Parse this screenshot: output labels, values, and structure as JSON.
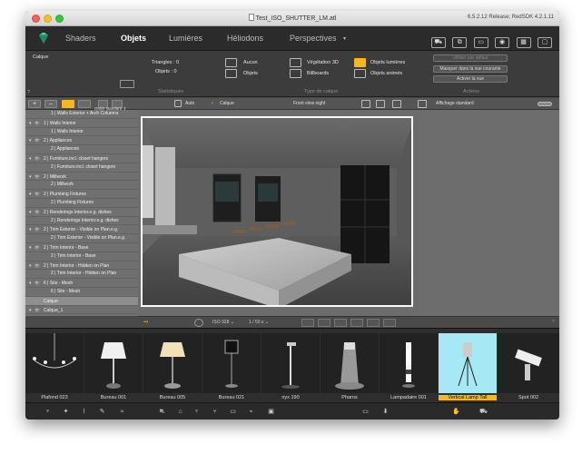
{
  "window": {
    "title": "Test_ISO_SHUTTER_LM.atl",
    "version": "6.5.2.12 Release; RedSDK 4.2.1.11"
  },
  "menu": {
    "tabs": [
      "Shaders",
      "Objets",
      "Lumières",
      "Héliodons",
      "Perspectives"
    ],
    "perspectives_arrow": "▾",
    "toolbar_icons": [
      "cart-icon",
      "layers-icon",
      "display-icon",
      "camera-icon",
      "film-icon",
      "screen-icon"
    ]
  },
  "info_panel": {
    "layer_label": "Calque",
    "triangles": "Triangles : 0",
    "objects": "Objets : 0",
    "stats_label": "Statistiques",
    "layer_type_label": "Type de calque",
    "actions_label": "Actions",
    "type_options": [
      {
        "label": "Aucun",
        "icon": "box-icon",
        "active": false
      },
      {
        "label": "Objets",
        "icon": "cube-icon",
        "active": false
      },
      {
        "label": "Végétation 3D",
        "icon": "tree-icon",
        "active": false
      },
      {
        "label": "Billboards",
        "icon": "billboard-icon",
        "active": false
      },
      {
        "label": "Objets lumières",
        "icon": "lamp-icon",
        "active": true
      },
      {
        "label": "Objets animés",
        "icon": "animation-icon",
        "active": false
      }
    ],
    "actions": [
      "Utiliser par défaut",
      "Masquer dans la vue courante",
      "Activer la vue"
    ],
    "help": "?"
  },
  "layer_toolbar": {
    "sort_label": "Ordre standard ⇕",
    "plus": "+",
    "minus": "–"
  },
  "layers": [
    {
      "kind": "s",
      "text": "1 | Walls Exterior + Arch Columns"
    },
    {
      "kind": "g",
      "text": "1 | Walls Interior"
    },
    {
      "kind": "s",
      "text": "1 | Walls Interior"
    },
    {
      "kind": "g",
      "text": "2 | Appliances"
    },
    {
      "kind": "s",
      "text": "2 | Appliances"
    },
    {
      "kind": "g",
      "text": "2 | Furniture.incl. closet hangers"
    },
    {
      "kind": "s",
      "text": "2 | Furniture.incl. closet hangers"
    },
    {
      "kind": "g",
      "text": "2 | Millwork"
    },
    {
      "kind": "s",
      "text": "2 | Millwork"
    },
    {
      "kind": "g",
      "text": "2 | Plumbing Fixtures"
    },
    {
      "kind": "s",
      "text": "2 | Plumbing Fixtures"
    },
    {
      "kind": "g",
      "text": "2 | Renderings Interior.e.g. dishes"
    },
    {
      "kind": "s",
      "text": "2 | Renderings Interior.e.g. dishes"
    },
    {
      "kind": "g",
      "text": "2 | Trim Exterior - Visible on Plan.e.g."
    },
    {
      "kind": "s",
      "text": "2 | Trim Exterior - Visible on Plan.e.g."
    },
    {
      "kind": "g",
      "text": "2 | Trim Interior - Base"
    },
    {
      "kind": "s",
      "text": "2 | Trim Interior - Base"
    },
    {
      "kind": "g",
      "text": "2 | Trim Interior - Hidden on Plan"
    },
    {
      "kind": "s",
      "text": "2 | Trim Interior - Hidden on Plan"
    },
    {
      "kind": "g",
      "text": "6 | Site - Mesh"
    },
    {
      "kind": "s",
      "text": "6 | Site - Mesh"
    },
    {
      "kind": "sel",
      "text": "Calque"
    },
    {
      "kind": "g",
      "text": "Calque_1"
    }
  ],
  "view_toolbar": {
    "auto": "Auto",
    "layer": "Calque",
    "view_name": "Front view night",
    "display": "Affichage standard"
  },
  "view_bottom": {
    "dots": "•••",
    "iso": "ISO 928 ⌄",
    "shutter": "1 / 50 s ⌄",
    "help": "?"
  },
  "objects": [
    {
      "name": "Plafond 023",
      "selected": false
    },
    {
      "name": "Bureau 001",
      "selected": false
    },
    {
      "name": "Bureau 005",
      "selected": false
    },
    {
      "name": "Bureau 021",
      "selected": false
    },
    {
      "name": "nyx 190",
      "selected": false
    },
    {
      "name": "Pharos",
      "selected": false
    },
    {
      "name": "Lampadaire 001",
      "selected": false
    },
    {
      "name": "Vertical Lamp Tall",
      "selected": true
    },
    {
      "name": "Spot 002",
      "selected": false
    }
  ],
  "footer_icons": [
    "lamp-icon",
    "bulb-icon",
    "stair-icon",
    "pen-icon",
    "wave-icon",
    "car-icon",
    "sofa-icon",
    "lamp-icon",
    "chair-icon",
    "bed-icon",
    "toilet-icon",
    "image-icon",
    "folder-icon",
    "download-icon",
    "hand-icon",
    "bag-icon"
  ]
}
